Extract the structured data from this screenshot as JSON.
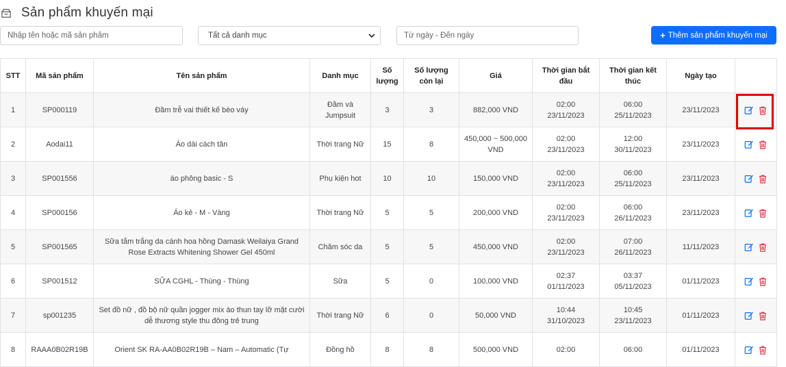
{
  "page": {
    "title": "Sản phẩm khuyến mại",
    "title_icon": "box-icon"
  },
  "filters": {
    "search_placeholder": "Nhập tên hoặc mã sản phẩm",
    "category_selected": "Tất cả danh mục",
    "date_placeholder": "Từ ngày - Đến ngày"
  },
  "toolbar": {
    "add_label": "Thêm sản phẩm khuyến mại",
    "add_color": "#0d6efd"
  },
  "table": {
    "headers": {
      "stt": "STT",
      "code": "Mã sản phẩm",
      "name": "Tên sản phẩm",
      "category": "Danh mục",
      "qty": "Số lượng",
      "remaining": "Số lượng còn lại",
      "price": "Giá",
      "start": "Thời gian bắt đầu",
      "end": "Thời gian kết thúc",
      "created": "Ngày tạo",
      "actions": ""
    },
    "rows": [
      {
        "stt": "1",
        "code": "SP000119",
        "name": "Đầm trễ vai thiết kế bèo váy",
        "category": "Đầm và Jumpsuit",
        "qty": "3",
        "remaining": "3",
        "price": "882,000 VND",
        "start_time": "02:00",
        "start_date": "23/11/2023",
        "end_time": "06:00",
        "end_date": "25/11/2023",
        "created": "23/11/2023"
      },
      {
        "stt": "2",
        "code": "Aodai11",
        "name": "Áo dài cách tân",
        "category": "Thời trang Nữ",
        "qty": "15",
        "remaining": "8",
        "price": "450,000 ~ 500,000 VND",
        "start_time": "02:00",
        "start_date": "23/11/2023",
        "end_time": "12:00",
        "end_date": "30/11/2023",
        "created": "23/11/2023"
      },
      {
        "stt": "3",
        "code": "SP001556",
        "name": "áo phông basic - S",
        "category": "Phụ kiện hot",
        "qty": "10",
        "remaining": "10",
        "price": "150,000 VND",
        "start_time": "02:00",
        "start_date": "23/11/2023",
        "end_time": "06:00",
        "end_date": "25/11/2023",
        "created": "23/11/2023"
      },
      {
        "stt": "4",
        "code": "SP000156",
        "name": "Áo kẻ - M - Vàng",
        "category": "Thời trang Nữ",
        "qty": "5",
        "remaining": "5",
        "price": "200,000 VND",
        "start_time": "02:00",
        "start_date": "23/11/2023",
        "end_time": "06:00",
        "end_date": "26/11/2023",
        "created": "23/11/2023"
      },
      {
        "stt": "5",
        "code": "SP001565",
        "name": "Sữa tắm trắng da cánh hoa hồng Damask Weilaiya Grand Rose Extracts Whitening Shower Gel 450ml",
        "category": "Chăm sóc da",
        "qty": "5",
        "remaining": "5",
        "price": "450,000 VND",
        "start_time": "02:00",
        "start_date": "23/11/2023",
        "end_time": "07:00",
        "end_date": "26/11/2023",
        "created": "11/11/2023"
      },
      {
        "stt": "6",
        "code": "SP001512",
        "name": "SỮA CGHL - Thùng - Thùng",
        "category": "Sữa",
        "qty": "5",
        "remaining": "0",
        "price": "100,000 VND",
        "start_time": "02:37",
        "start_date": "01/11/2023",
        "end_time": "03:37",
        "end_date": "05/11/2023",
        "created": "01/11/2023"
      },
      {
        "stt": "7",
        "code": "sp001235",
        "name": "Set đồ nữ , đồ bộ nữ quần jogger mix áo thun tay lỡ mặt cười dễ thương style thu đông trẻ trung",
        "category": "Thời trang Nữ",
        "qty": "6",
        "remaining": "0",
        "price": "50,000 VND",
        "start_time": "10:44",
        "start_date": "31/10/2023",
        "end_time": "10:45",
        "end_date": "23/11/2023",
        "created": "01/11/2023"
      },
      {
        "stt": "8",
        "code": "RAAA0B02R19B",
        "name": "Orient SK RA-AA0B02R19B – Nam – Automatic (Tự",
        "category": "Đồng hồ",
        "qty": "8",
        "remaining": "8",
        "price": "500,000 VND",
        "start_time": "02:00",
        "start_date": "",
        "end_time": "06:00",
        "end_date": "",
        "created": "01/11/2023"
      }
    ]
  },
  "colors": {
    "edit_icon": "#0d6efd",
    "delete_icon": "#dc3545",
    "highlight": "#e00000"
  }
}
